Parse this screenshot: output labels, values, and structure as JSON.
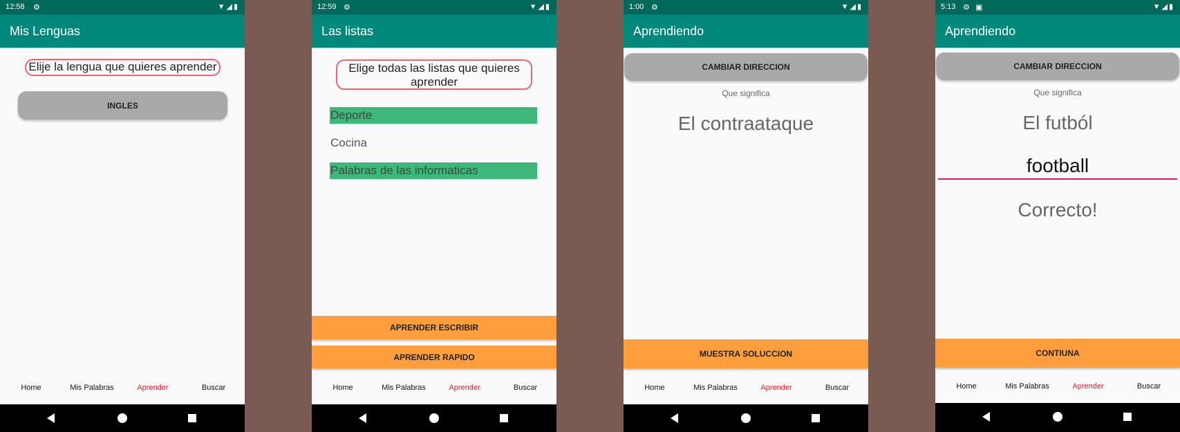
{
  "screens": [
    {
      "status": {
        "time": "12:58"
      },
      "appbar": {
        "title": "Mis Lenguas"
      },
      "prompt": "Elije la lengua que quieres aprender",
      "language_button": "INGLES",
      "bottom_nav": [
        "Home",
        "Mis Palabras",
        "Aprender",
        "Buscar"
      ],
      "active_nav": "Aprender"
    },
    {
      "status": {
        "time": "12:59"
      },
      "appbar": {
        "title": "Las listas"
      },
      "prompt": "Elige todas las listas que quieres aprender",
      "lists": [
        {
          "label": "Deporte",
          "selected": true
        },
        {
          "label": "Cocina",
          "selected": false
        },
        {
          "label": "Palabras de las informaticas",
          "selected": true
        }
      ],
      "buttons": {
        "write": "APRENDER ESCRIBIR",
        "fast": "APRENDER RAPIDO"
      },
      "bottom_nav": [
        "Home",
        "Mis Palabras",
        "Aprender",
        "Buscar"
      ],
      "active_nav": "Aprender"
    },
    {
      "status": {
        "time": "1:00"
      },
      "appbar": {
        "title": "Aprendiendo"
      },
      "change_direction": "CAMBIAR DIRECCION",
      "question": "Que significa",
      "word": "El contraataque",
      "show_solution": "MUESTRA SOLUCCION",
      "bottom_nav": [
        "Home",
        "Mis Palabras",
        "Aprender",
        "Buscar"
      ],
      "active_nav": "Aprender"
    },
    {
      "status": {
        "time": "5:13"
      },
      "appbar": {
        "title": "Aprendiendo"
      },
      "change_direction": "CAMBIAR DIRECCION",
      "question": "Que significa",
      "word": "El futból",
      "answer": "football",
      "result": "Correcto!",
      "continue": "CONTIUNA",
      "bottom_nav": [
        "Home",
        "Mis Palabras",
        "Aprender",
        "Buscar"
      ],
      "active_nav": "Aprender"
    }
  ],
  "colors": {
    "status_bar": "#00695c",
    "app_bar": "#00897b",
    "selected_list": "#3cb97a",
    "orange_button": "#ff9e3d",
    "gray_button": "#a9a9a9",
    "active_nav": "#e8192c",
    "outline": "#f06472",
    "answer_underline": "#e8195c",
    "background_gap": "#7a5b53"
  },
  "icons": {
    "status_left": "settings-gear-icon",
    "status_right": [
      "wifi-icon",
      "signal-icon",
      "battery-icon"
    ],
    "status_extra_screen4": "notification-icon",
    "system_nav": [
      "back-icon",
      "home-icon",
      "recents-icon"
    ]
  }
}
